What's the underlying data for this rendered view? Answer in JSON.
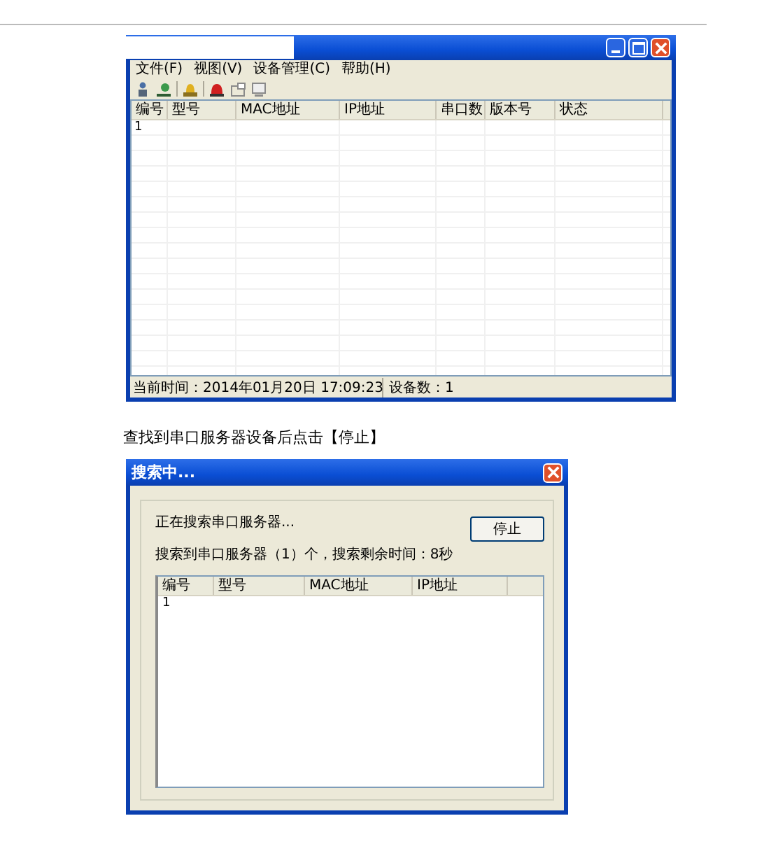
{
  "main_window": {
    "menu": [
      "文件(F)",
      "视图(V)",
      "设备管理(C)",
      "帮助(H)"
    ],
    "table": {
      "columns": [
        "编号",
        "型号",
        "MAC地址",
        "IP地址",
        "串口数",
        "版本号",
        "状态"
      ],
      "rows": [
        [
          "1"
        ]
      ]
    },
    "status_bar": [
      "当前时间：2014年01月20日 17:09:23",
      "设备数：1"
    ]
  },
  "caption": "查找到串口服务器设备后点击【停止】",
  "dialog": {
    "title": "搜索中...",
    "status_lines": [
      "正在搜索串口服务器...",
      "搜索到串口服务器（1）个，搜索剩余时间：8秒"
    ],
    "button": "停止",
    "table": {
      "columns": [
        "编号",
        "型号",
        "MAC地址",
        "IP地址"
      ],
      "rows": [
        [
          "1"
        ]
      ]
    }
  }
}
